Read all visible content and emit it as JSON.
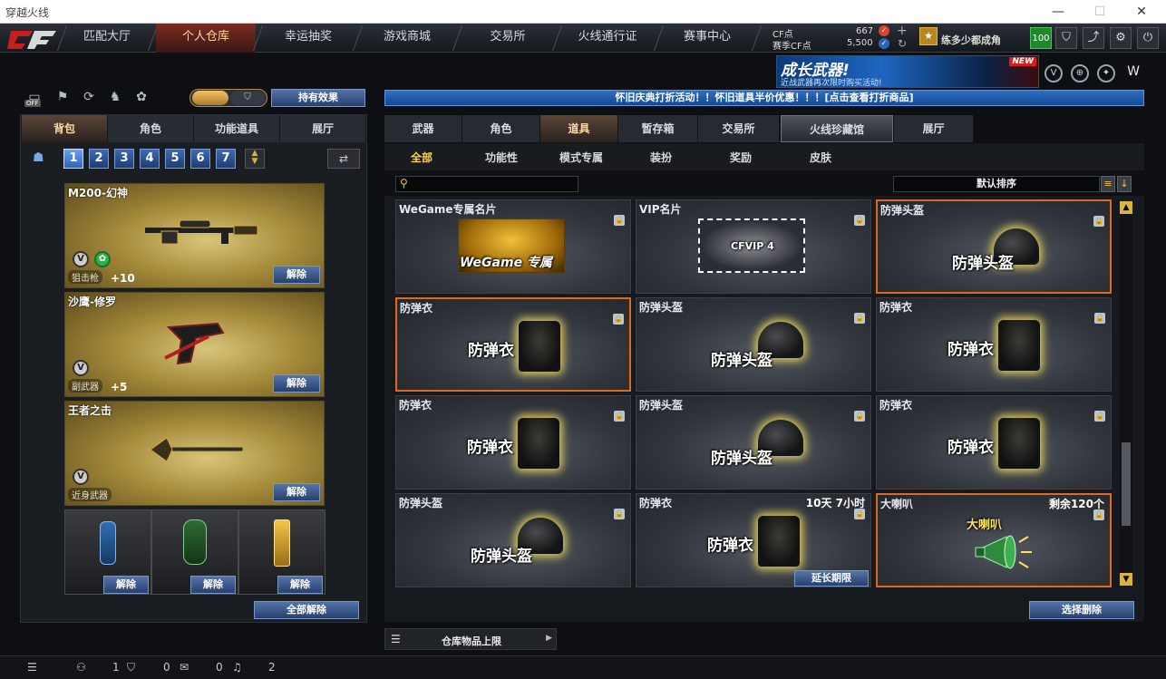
{
  "window": {
    "title": "穿越火线",
    "minimize": "—",
    "maximize": "☐",
    "close": "✕"
  },
  "nav": {
    "logo": "CF",
    "tabs": [
      "匹配大厅",
      "个人仓库",
      "幸运抽奖",
      "游戏商城",
      "交易所",
      "火线通行证",
      "赛事中心"
    ],
    "active": 1
  },
  "currency": {
    "cf_label": "CF点",
    "cf_value": "667",
    "match_label": "赛季CF点",
    "match_value": "5,500"
  },
  "user": {
    "name": "练多少都成角",
    "level": "100"
  },
  "banner": {
    "title": "成长武器!",
    "subtitle": "近战武器再次限时购买活动!",
    "badge": "NEW"
  },
  "left": {
    "toggle_off": "OFF",
    "effects_button": "持有效果",
    "tabs": [
      "背包",
      "角色",
      "功能道具",
      "展厅"
    ],
    "active_tab": 0,
    "pages": [
      "1",
      "2",
      "3",
      "4",
      "5",
      "6",
      "7"
    ],
    "active_page": 0,
    "slots": [
      {
        "name": "M200-幻神",
        "type": "狙击枪",
        "bonus": "+10",
        "unequip": "解除"
      },
      {
        "name": "沙鹰-修罗",
        "type": "副武器",
        "bonus": "+5",
        "unequip": "解除"
      },
      {
        "name": "王者之击",
        "type": "近身武器",
        "bonus": "",
        "unequip": "解除"
      }
    ],
    "grenades": [
      {
        "unequip": "解除"
      },
      {
        "unequip": "解除"
      },
      {
        "unequip": "解除"
      }
    ],
    "unequip_all": "全部解除"
  },
  "right": {
    "notice": "怀旧庆典打折活动！！怀旧道具半价优惠！！！[点击查看打折商品]",
    "tabs": [
      "武器",
      "角色",
      "道具",
      "暂存箱",
      "交易所",
      "火线珍藏馆",
      "展厅"
    ],
    "active_tab": 2,
    "subtabs": [
      "全部",
      "功能性",
      "模式专属",
      "装扮",
      "奖励",
      "皮肤"
    ],
    "active_subtab": 0,
    "search_placeholder": "",
    "sort_label": "默认排序",
    "items": [
      {
        "name": "WeGame专属名片",
        "art": "WeGame 专属",
        "info": ""
      },
      {
        "name": "VIP名片",
        "art": "CFVIP 4",
        "info": ""
      },
      {
        "name": "防弹头盔",
        "art": "防弹头盔",
        "info": ""
      },
      {
        "name": "防弹衣",
        "art": "防弹衣",
        "info": ""
      },
      {
        "name": "防弹头盔",
        "art": "防弹头盔",
        "info": ""
      },
      {
        "name": "防弹衣",
        "art": "防弹衣",
        "info": ""
      },
      {
        "name": "防弹衣",
        "art": "防弹衣",
        "info": ""
      },
      {
        "name": "防弹头盔",
        "art": "防弹头盔",
        "info": ""
      },
      {
        "name": "防弹衣",
        "art": "防弹衣",
        "info": ""
      },
      {
        "name": "防弹头盔",
        "art": "防弹头盔",
        "info": ""
      },
      {
        "name": "防弹衣",
        "art": "防弹衣",
        "info": "10天 7小时",
        "action": "延长期限"
      },
      {
        "name": "大喇叭",
        "art": "大喇叭",
        "info": "剩余120个"
      }
    ],
    "capacity_label": "仓库物品上限",
    "select_delete": "选择删除"
  },
  "statusbar": {
    "friends": "1",
    "shield": "0",
    "chat": "0",
    "sound": "2"
  },
  "colors": {
    "accent": "#e2681f",
    "gold": "#d4b34a",
    "blue": "#2f63b8"
  }
}
